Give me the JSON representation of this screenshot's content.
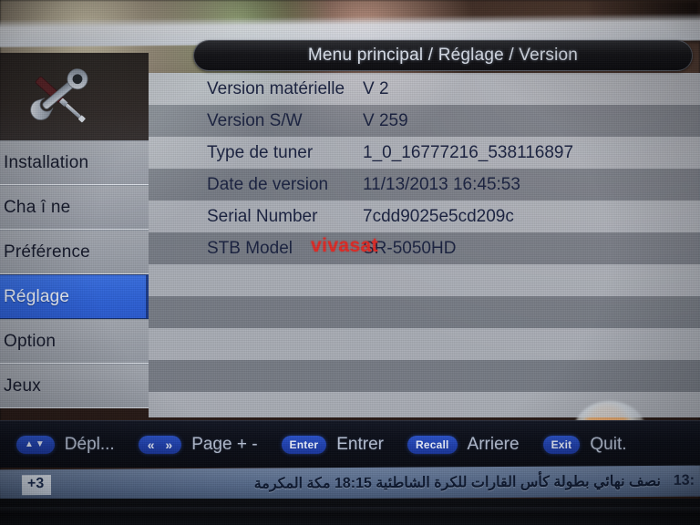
{
  "header": {
    "title": "Menu principal / Réglage / Version"
  },
  "sidebar": {
    "icon": "tools-wrench-screwdriver-icon",
    "items": [
      {
        "label": "Installation",
        "selected": false
      },
      {
        "label": "Cha î ne",
        "selected": false
      },
      {
        "label": "Préférence",
        "selected": false
      },
      {
        "label": "Réglage",
        "selected": true
      },
      {
        "label": "Option",
        "selected": false
      },
      {
        "label": "Jeux",
        "selected": false
      }
    ]
  },
  "main": {
    "watermark": "vivasat",
    "rows": [
      {
        "label": "Version matérielle",
        "value": "V 2"
      },
      {
        "label": "Version S/W",
        "value": "V 259"
      },
      {
        "label": "Type de tuner",
        "value": "1_0_16777216_538116897"
      },
      {
        "label": "Date de version",
        "value": "11/13/2013 16:45:53"
      },
      {
        "label": "Serial Number",
        "value": "7cdd9025e5cd209c"
      },
      {
        "label": "STB Model",
        "value": "SR-5050HD"
      },
      {
        "label": "",
        "value": ""
      },
      {
        "label": "",
        "value": ""
      },
      {
        "label": "",
        "value": ""
      },
      {
        "label": "",
        "value": ""
      }
    ]
  },
  "footer": {
    "hints": [
      {
        "key": "▲▼",
        "label": "Dépl..."
      },
      {
        "key": "« »",
        "label": "Page + -"
      },
      {
        "key": "Enter",
        "label": "Entrer"
      },
      {
        "key": "Recall",
        "label": "Arriere"
      },
      {
        "key": "Exit",
        "label": "Quit."
      }
    ]
  },
  "ticker": {
    "badge": "+3",
    "text": "نصف نهائي بطولة كأس القارات للكرة الشاطئية 18:15 مكة المكرمة",
    "clock": "13:"
  },
  "colors": {
    "accent": "#2f63d8",
    "watermark": "#e02b26",
    "title_text": "#dde3ee",
    "row_light": "#d0d8e4",
    "row_dark": "#96a2b2"
  }
}
